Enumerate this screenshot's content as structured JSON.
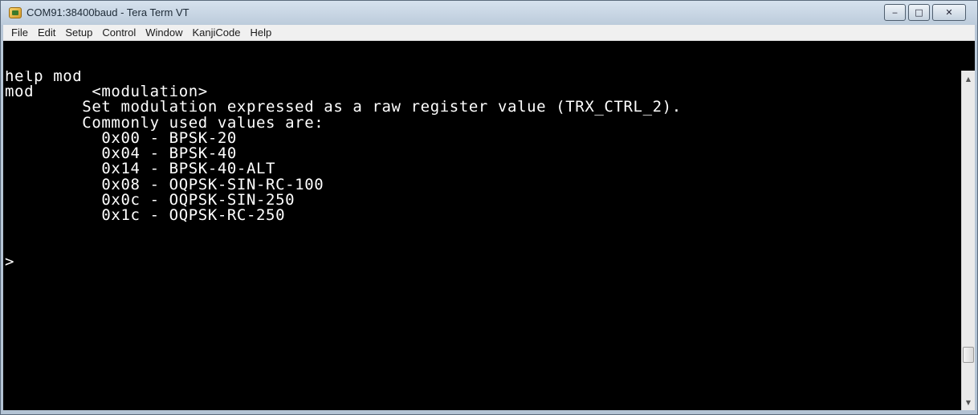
{
  "window": {
    "title": "COM91:38400baud - Tera Term VT",
    "controls": {
      "minimize": "‒",
      "maximize": "□",
      "close": "✕"
    }
  },
  "menu": [
    "File",
    "Edit",
    "Setup",
    "Control",
    "Window",
    "KanjiCode",
    "Help"
  ],
  "terminal": {
    "lines": [
      "",
      "",
      "help mod",
      "mod      <modulation>",
      "        Set modulation expressed as a raw register value (TRX_CTRL_2).",
      "        Commonly used values are:",
      "          0x00 - BPSK-20",
      "          0x04 - BPSK-40",
      "          0x14 - BPSK-40-ALT",
      "          0x08 - OQPSK-SIN-RC-100",
      "          0x0c - OQPSK-SIN-250",
      "          0x1c - OQPSK-RC-250",
      "",
      "",
      ">"
    ]
  },
  "icons": {
    "app": "tera-term-icon",
    "scroll_up": "scroll-up-arrow-icon",
    "scroll_down": "scroll-down-arrow-icon"
  }
}
